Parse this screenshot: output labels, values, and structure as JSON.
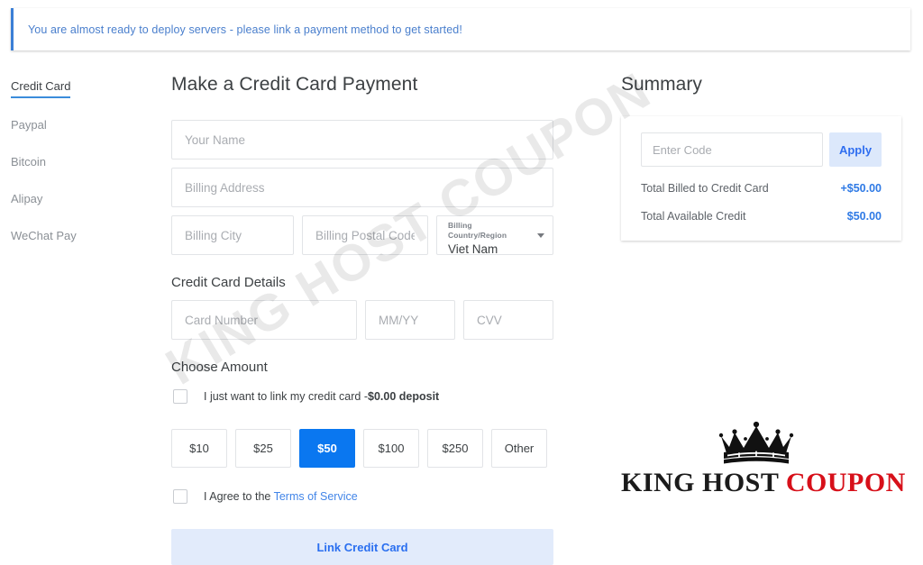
{
  "banner": {
    "message": "You are almost ready to deploy servers - please link a payment method to get started!",
    "accent_color": "#3b7fd6",
    "text_color": "#4a7fcd"
  },
  "watermark": {
    "text": "KING HOST COUPON"
  },
  "sidebar": {
    "items": [
      {
        "label": "Credit Card",
        "active": true
      },
      {
        "label": "Paypal",
        "active": false
      },
      {
        "label": "Bitcoin",
        "active": false
      },
      {
        "label": "Alipay",
        "active": false
      },
      {
        "label": "WeChat Pay",
        "active": false
      }
    ]
  },
  "main": {
    "title": "Make a Credit Card Payment",
    "billing": {
      "name_placeholder": "Your Name",
      "name_value": "",
      "address_placeholder": "Billing Address",
      "address_value": "",
      "city_placeholder": "Billing City",
      "city_value": "",
      "postal_placeholder": "Billing Postal Code",
      "postal_value": "",
      "country_label": "Billing Country/Region",
      "country_value": "Viet Nam"
    },
    "card_section_title": "Credit Card Details",
    "card": {
      "number_placeholder": "Card Number",
      "number_value": "",
      "expiry_placeholder": "MM/YY",
      "expiry_value": "",
      "cvv_placeholder": "CVV",
      "cvv_value": ""
    },
    "amount_section_title": "Choose Amount",
    "link_only": {
      "text_prefix": "I just want to link my credit card -",
      "text_bold": "$0.00 deposit",
      "checked": false
    },
    "amounts": [
      {
        "label": "$10",
        "selected": false
      },
      {
        "label": "$25",
        "selected": false
      },
      {
        "label": "$50",
        "selected": true
      },
      {
        "label": "$100",
        "selected": false
      },
      {
        "label": "$250",
        "selected": false
      },
      {
        "label": "Other",
        "selected": false
      }
    ],
    "selected_accent": "#0a77f0",
    "terms": {
      "text_prefix": "I Agree to the ",
      "link_text": "Terms of Service",
      "checked": false
    },
    "submit_label": "Link Credit Card"
  },
  "summary": {
    "title": "Summary",
    "code_placeholder": "Enter Code",
    "code_value": "",
    "apply_label": "Apply",
    "rows": [
      {
        "label": "Total Billed to Credit Card",
        "value": "+$50.00"
      },
      {
        "label": "Total Available Credit",
        "value": "$50.00"
      }
    ]
  },
  "logo": {
    "word1": "KING HOST",
    "word2": "COUPON",
    "color1": "#1b1b1b",
    "color2": "#d7101a"
  }
}
